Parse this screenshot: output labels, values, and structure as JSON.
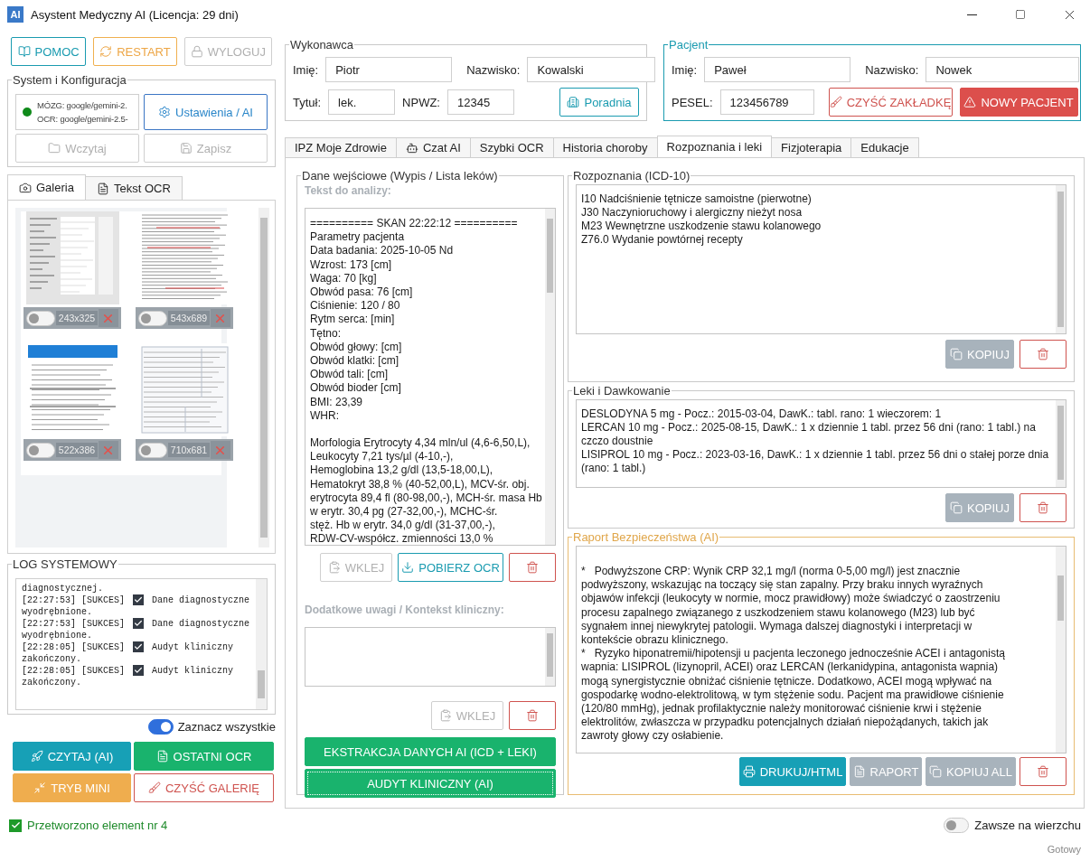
{
  "window": {
    "title": "Asystent Medyczny AI (Licencja: 29 dni)",
    "logo": "AI"
  },
  "top_buttons": [
    {
      "label": "POMOC",
      "kind": "teal-outline"
    },
    {
      "label": "RESTART",
      "kind": "orange-outline"
    },
    {
      "label": "WYLOGUJ",
      "kind": "muted"
    }
  ],
  "system": {
    "title": "System i Konfiguracja",
    "connected": true,
    "brain": "MÓZG: google/gemini-2.",
    "ocr": "OCR: google/gemini-2.5-",
    "buttons": [
      {
        "label": "Ustawienia / AI",
        "kind": "blue-outline"
      },
      {
        "label": "Wczytaj",
        "kind": "muted"
      },
      {
        "label": "Zapisz",
        "kind": "muted"
      }
    ]
  },
  "left_tabs": [
    {
      "label": "Galeria",
      "selected": true
    },
    {
      "label": "Tekst OCR",
      "selected": false
    }
  ],
  "gallery": {
    "items": [
      {
        "size": "243x325",
        "on": false
      },
      {
        "size": "543x689",
        "on": false
      },
      {
        "size": "522x386",
        "on": false
      },
      {
        "size": "710x681",
        "on": false
      }
    ]
  },
  "log": {
    "title": "LOG SYSTEMOWY",
    "entries": [
      {
        "kind": "wrap",
        "text": "diagnostycznej."
      },
      {
        "kind": "event",
        "prefix": "[22:27:53] [SUKCES]",
        "message": "Dane diagnostyczne"
      },
      {
        "kind": "wrap",
        "text": "wyodrębnione."
      },
      {
        "kind": "event",
        "prefix": "[22:27:53] [SUKCES]",
        "message": "Dane diagnostyczne"
      },
      {
        "kind": "wrap",
        "text": "wyodrębnione."
      },
      {
        "kind": "event",
        "prefix": "[22:28:05] [SUKCES]",
        "message": "Audyt kliniczny"
      },
      {
        "kind": "wrap",
        "text": "zakończony."
      },
      {
        "kind": "event",
        "prefix": "[22:28:05] [SUKCES]",
        "message": "Audyt kliniczny"
      },
      {
        "kind": "wrap",
        "text": "zakończony."
      }
    ]
  },
  "select_all": {
    "label": "Zaznacz wszystkie",
    "on": true
  },
  "action_buttons": [
    {
      "label": "CZYTAJ (AI)",
      "kind": "teal"
    },
    {
      "label": "OSTATNI OCR",
      "kind": "green"
    },
    {
      "label": "TRYB MINI",
      "kind": "orange"
    },
    {
      "label": "CZYŚĆ GALERIĘ",
      "kind": "red-outline"
    }
  ],
  "status": {
    "message": "Przetworzono element nr 4",
    "ok": true
  },
  "performer": {
    "title": "Wykonawca",
    "fields": [
      {
        "label": "Imię:",
        "value": "Piotr"
      },
      {
        "label": "Nazwisko:",
        "value": "Kowalski"
      },
      {
        "label": "Tytuł:",
        "value": "lek."
      },
      {
        "label": "NPWZ:",
        "value": "12345"
      }
    ],
    "button": {
      "label": "Poradnia",
      "kind": "teal-outline"
    }
  },
  "patient": {
    "title": "Pacjent",
    "fields": [
      {
        "label": "Imię:",
        "value": "Paweł"
      },
      {
        "label": "Nazwisko:",
        "value": "Nowek"
      },
      {
        "label": "PESEL:",
        "value": "123456789"
      }
    ],
    "buttons": [
      {
        "label": "CZYŚĆ ZAKŁADKĘ",
        "kind": "red-outline"
      },
      {
        "label": "NOWY PACJENT",
        "kind": "red"
      }
    ]
  },
  "tabs": [
    {
      "label": "IPZ Moje Zdrowie",
      "selected": false
    },
    {
      "label": "Czat AI",
      "selected": false
    },
    {
      "label": "Szybki OCR",
      "selected": false
    },
    {
      "label": "Historia choroby",
      "selected": false
    },
    {
      "label": "Rozpoznania i leki",
      "selected": true
    },
    {
      "label": "Fizjoterapia",
      "selected": false
    },
    {
      "label": "Edukacje",
      "selected": false
    }
  ],
  "input_panel": {
    "title": "Dane wejściowe (Wypis / Lista leków)",
    "text_label": "Tekst do analizy:",
    "text_blocks": [
      [
        "========== SKAN 22:22:12 ==========",
        "Parametry pacjenta",
        "Data badania: 2025-10-05 Nd",
        "Wzrost: 173 [cm]",
        "Waga: 70 [kg]",
        "Obwód pasa: 76 [cm]",
        "Ciśnienie: 120 / 80",
        "Rytm serca: [min]",
        "Tętno:",
        "Obwód głowy: [cm]",
        "Obwód klatki: [cm]",
        "Obwód tali: [cm]",
        "Obwód bioder [cm]",
        "BMI: 23,39",
        "WHR:"
      ],
      [
        "Morfologia Erytrocyty 4,34 mln/ul (4,6-6,50,L),",
        "Leukocyty 7,21 tys/µl (4-10,-),",
        "Hemoglobina 13,2 g/dl (13,5-18,00,L),",
        "Hematokryt 38,8 % (40-52,00,L), MCV-śr. obj.",
        "erytrocyta 89,4 fl (80-98,00,-), MCH-śr. masa Hb",
        "w erytr. 30,4 pg (27-32,00,-), MCHC-śr.",
        "stęż. Hb w erytr. 34,0 g/dl (31-37,00,-),",
        "RDW-CV-współcz. zmienności 13,0 %"
      ]
    ],
    "text_buttons": [
      {
        "label": "WKLEJ",
        "kind": "muted"
      },
      {
        "label": "POBIERZ OCR",
        "kind": "teal-outline"
      },
      {
        "kind": "red-outline"
      }
    ],
    "notes_label": "Dodatkowe uwagi / Kontekst kliniczny:",
    "notes_buttons": [
      {
        "label": "WKLEJ",
        "kind": "muted"
      },
      {
        "kind": "red-outline"
      }
    ],
    "actions": [
      {
        "label": "EKSTRAKCJA DANYCH AI (ICD + LEKI)",
        "kind": "green",
        "focused": false
      },
      {
        "label": "AUDYT KLINICZNY (AI)",
        "kind": "green",
        "focused": true
      }
    ]
  },
  "diagnoses": {
    "title": "Rozpoznania (ICD-10)",
    "lines": [
      "I10 Nadciśnienie tętnicze samoistne (pierwotne)",
      "J30 Naczynioruchowy i alergiczny nieżyt nosa",
      "M23 Wewnętrzne uszkodzenie stawu kolanowego",
      "Z76.0 Wydanie powtórnej recepty"
    ],
    "buttons": [
      {
        "label": "KOPIUJ",
        "kind": "grey"
      },
      {
        "kind": "red-outline"
      }
    ]
  },
  "medications": {
    "title": "Leki i Dawkowanie",
    "lines": [
      "DESLODYNA 5 mg - Pocz.: 2015-03-04, DawK.: tabl. rano: 1 wieczorem: 1",
      "LERCAN 10 mg - Pocz.: 2025-08-15, DawK.: 1 x dziennie 1 tabl. przez 56 dni (rano: 1 tabl.) na",
      "czczo doustnie",
      "LISIPROL 10 mg - Pocz.: 2023-03-16, DawK.: 1 x dziennie 1 tabl. przez 56 dni o stałej porze dnia",
      "(rano: 1 tabl.)"
    ],
    "buttons": [
      {
        "label": "KOPIUJ",
        "kind": "grey"
      },
      {
        "kind": "red-outline"
      }
    ]
  },
  "report": {
    "title": "Raport Bezpieczeństwa (AI)",
    "lines": [
      "*   Podwyższone CRP: Wynik CRP 32,1 mg/l (norma 0-5,00 mg/l) jest znacznie",
      "podwyższony, wskazując na toczący się stan zapalny. Przy braku innych wyraźnych",
      "objawów infekcji (leukocyty w normie, mocz prawidłowy) może świadczyć o zaostrzeniu",
      "procesu zapalnego związanego z uszkodzeniem stawu kolanowego (M23) lub być",
      "sygnałem innej niewykrytej patologii. Wymaga dalszej diagnostyki i interpretacji w",
      "kontekście obrazu klinicznego.",
      "*   Ryzyko hiponatremii/hipotensji u pacjenta leczonego jednocześnie ACEI i antagonistą",
      "wapnia: LISIPROL (lizynopril, ACEI) oraz LERCAN (lerkanidypina, antagonista wapnia)",
      "mogą synergistycznie obniżać ciśnienie tętnicze. Dodatkowo, ACEI mogą wpływać na",
      "gospodarkę wodno-elektrolitową, w tym stężenie sodu. Pacjent ma prawidłowe ciśnienie",
      "(120/80 mmHg), jednak profilaktycznie należy monitorować ciśnienie krwi i stężenie",
      "elektrolitów, zwłaszcza w przypadku potencjalnych działań niepożądanych, takich jak",
      "zawroty głowy czy osłabienie."
    ],
    "buttons": [
      {
        "label": "DRUKUJ/HTML",
        "kind": "teal"
      },
      {
        "label": "RAPORT",
        "kind": "grey"
      },
      {
        "label": "KOPIUJ ALL",
        "kind": "grey"
      },
      {
        "kind": "red-outline"
      }
    ]
  },
  "always_on_top": {
    "label": "Zawsze na wierzchu",
    "on": false
  },
  "status_bar": "Gotowy"
}
